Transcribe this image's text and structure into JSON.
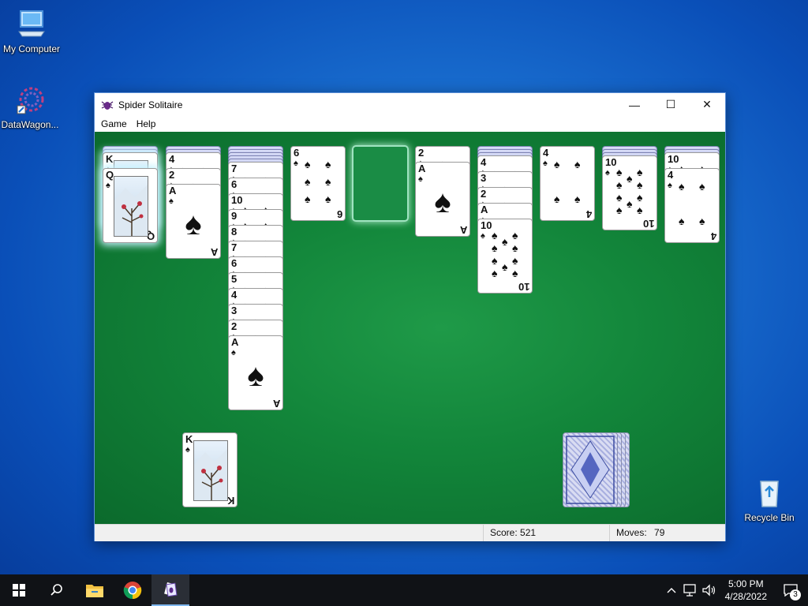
{
  "desktop": {
    "icons": [
      {
        "label": "My Computer",
        "icon": "computer-icon"
      },
      {
        "label": "DataWagon...",
        "icon": "datawagon-icon"
      },
      {
        "label": "Recycle Bin",
        "icon": "recycle-bin-icon"
      }
    ]
  },
  "window": {
    "title": "Spider Solitaire",
    "app_icon": "spider-icon",
    "controls": {
      "minimize": "—",
      "maximize": "☐",
      "close": "✕"
    },
    "menu": [
      "Game",
      "Help"
    ]
  },
  "game": {
    "columns": [
      {
        "hidden": 2,
        "cards": [
          {
            "rank": "K",
            "suit": "♠",
            "face": true
          },
          {
            "rank": "Q",
            "suit": "♠",
            "face": true
          }
        ],
        "highlight": true
      },
      {
        "hidden": 2,
        "cards": [
          {
            "rank": "4",
            "suit": "♠"
          },
          {
            "rank": "2",
            "suit": "♠"
          },
          {
            "rank": "A",
            "suit": "♠"
          }
        ]
      },
      {
        "hidden": 5,
        "cards": [
          {
            "rank": "7",
            "suit": "♠"
          },
          {
            "rank": "6",
            "suit": "♠"
          },
          {
            "rank": "10",
            "suit": "♠"
          },
          {
            "rank": "9",
            "suit": "♠"
          },
          {
            "rank": "8",
            "suit": "♠"
          },
          {
            "rank": "7",
            "suit": "♠"
          },
          {
            "rank": "6",
            "suit": "♠"
          },
          {
            "rank": "5",
            "suit": "♠"
          },
          {
            "rank": "4",
            "suit": "♠"
          },
          {
            "rank": "3",
            "suit": "♠"
          },
          {
            "rank": "2",
            "suit": "♠"
          },
          {
            "rank": "A",
            "suit": "♠"
          }
        ]
      },
      {
        "hidden": 0,
        "cards": [
          {
            "rank": "6",
            "suit": "♠"
          }
        ]
      },
      {
        "hidden": 0,
        "cards": [],
        "empty": true
      },
      {
        "hidden": 0,
        "cards": [
          {
            "rank": "2",
            "suit": "♠"
          },
          {
            "rank": "A",
            "suit": "♠"
          }
        ]
      },
      {
        "hidden": 3,
        "cards": [
          {
            "rank": "4",
            "suit": "♠"
          },
          {
            "rank": "3",
            "suit": "♠"
          },
          {
            "rank": "2",
            "suit": "♠"
          },
          {
            "rank": "A",
            "suit": "♠"
          },
          {
            "rank": "10",
            "suit": "♠"
          }
        ]
      },
      {
        "hidden": 0,
        "cards": [
          {
            "rank": "4",
            "suit": "♠"
          }
        ]
      },
      {
        "hidden": 3,
        "cards": [
          {
            "rank": "10",
            "suit": "♠"
          }
        ]
      },
      {
        "hidden": 2,
        "cards": [
          {
            "rank": "10",
            "suit": "♠"
          },
          {
            "rank": "4",
            "suit": "♠"
          }
        ]
      }
    ],
    "completed_pile": {
      "rank": "K",
      "suit": "♠"
    },
    "stock_piles": 4
  },
  "status": {
    "score_label": "Score:",
    "score": "521",
    "moves_label": "Moves:",
    "moves": "79"
  },
  "taskbar": {
    "items": [
      "windows-start-icon",
      "search-icon",
      "file-explorer-icon",
      "chrome-icon",
      "spider-solitaire-icon"
    ],
    "tray": [
      "chevron-up-icon",
      "network-icon",
      "volume-icon"
    ],
    "time": "5:00 PM",
    "date": "4/28/2022",
    "notifications": "3"
  }
}
